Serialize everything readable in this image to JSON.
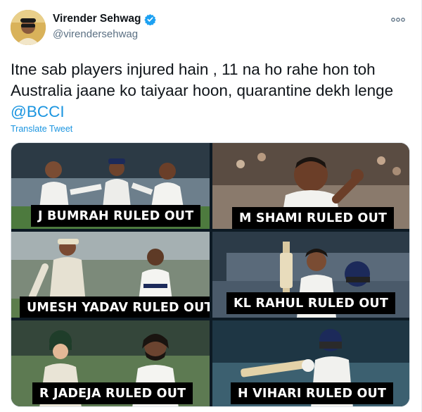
{
  "author": {
    "display_name": "Virender Sehwag",
    "handle": "@virendersehwag",
    "verified": true,
    "avatar_icon": "profile-photo"
  },
  "tweet": {
    "text_line_1": "Itne sab players injured hain , 11 na ho rahe hon toh",
    "text_line_2": "Australia jaane ko taiyaar hoon, quarantine dekh lenge",
    "mention": "@BCCI",
    "translate_label": "Translate Tweet"
  },
  "media": {
    "panels": [
      {
        "caption": "J BUMRAH RULED OUT"
      },
      {
        "caption": "M SHAMI RULED OUT"
      },
      {
        "caption": "UMESH YADAV RULED OUT"
      },
      {
        "caption": "KL RAHUL RULED OUT"
      },
      {
        "caption": "R JADEJA RULED OUT"
      },
      {
        "caption": "H VIHARI RULED OUT"
      }
    ]
  },
  "colors": {
    "link": "#1b95e0",
    "verified": "#1da1f2",
    "secondary_text": "#5b7083"
  }
}
